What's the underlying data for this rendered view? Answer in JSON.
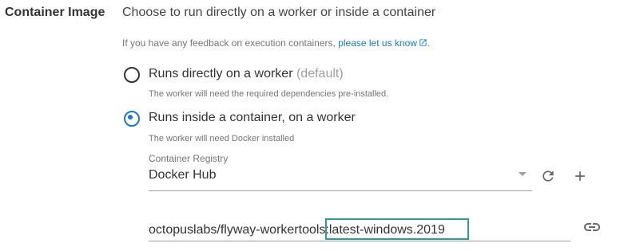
{
  "section": {
    "label": "Container Image",
    "description": "Choose to run directly on a worker or inside a container"
  },
  "feedback": {
    "text": "If you have any feedback on execution containers, ",
    "link": "please let us know",
    "link_icon": "external-link-icon",
    "suffix": "."
  },
  "options": [
    {
      "label": "Runs directly on a worker",
      "suffix": "(default)",
      "helper": "The worker will need the required dependencies pre-installed.",
      "selected": false
    },
    {
      "label": "Runs inside a container, on a worker",
      "helper": "The worker will need Docker installed",
      "selected": true
    }
  ],
  "registry": {
    "label": "Container Registry",
    "value": "Docker Hub",
    "dropdown_icon": "caret-down-icon",
    "refresh_icon": "refresh-icon",
    "add_icon": "plus-icon"
  },
  "image": {
    "value": "octopuslabs/flyway-workertools:latest-windows.2019",
    "bind_icon": "link-icon"
  },
  "colors": {
    "accent": "#1a77ca",
    "highlight": "#2b9e8d"
  }
}
